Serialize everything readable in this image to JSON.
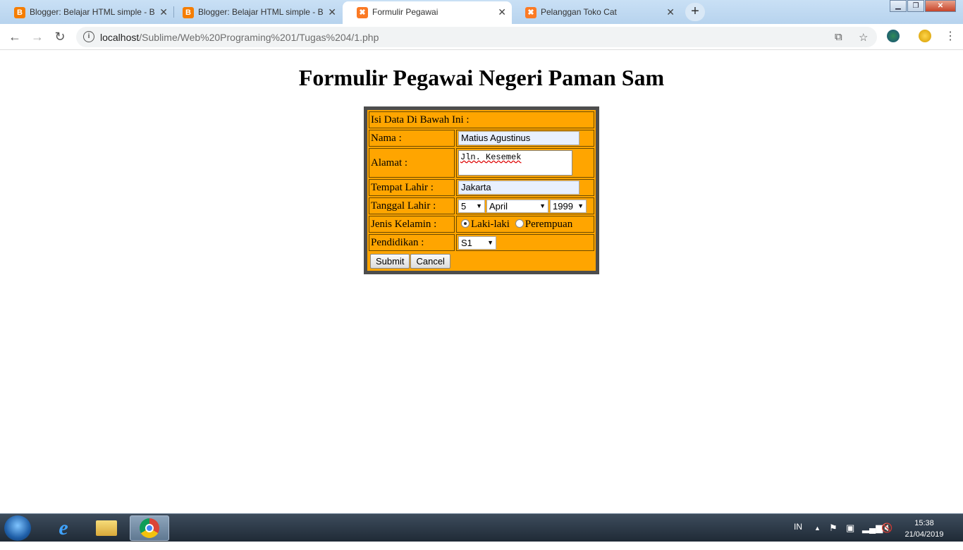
{
  "browser": {
    "tabs": [
      {
        "title": "Blogger: Belajar HTML simple - B",
        "icon": "blogger-icon",
        "active": false
      },
      {
        "title": "Blogger: Belajar HTML simple - B",
        "icon": "blogger-icon",
        "active": false
      },
      {
        "title": "Formulir Pegawai",
        "icon": "xampp-icon",
        "active": true
      },
      {
        "title": "Pelanggan Toko Cat",
        "icon": "xampp-icon",
        "active": false
      }
    ],
    "url_host": "localhost",
    "url_path": "/Sublime/Web%20Programing%201/Tugas%204/1.php"
  },
  "page": {
    "title": "Formulir Pegawai Negeri Paman Sam",
    "form": {
      "header": "Isi Data Di Bawah Ini :",
      "nama_label": "Nama :",
      "nama_value": "Matius Agustinus",
      "alamat_label": "Alamat :",
      "alamat_value": "Jln. Kesemek",
      "tempat_label": "Tempat Lahir :",
      "tempat_value": "Jakarta",
      "tanggal_label": "Tanggal Lahir :",
      "tanggal_day": "5",
      "tanggal_month": "April",
      "tanggal_year": "1999",
      "jk_label": "Jenis Kelamin :",
      "jk_option_1": "Laki-laki",
      "jk_option_2": "Perempuan",
      "jk_selected": "Laki-laki",
      "pendidikan_label": "Pendidikan :",
      "pendidikan_value": "S1",
      "submit_label": "Submit",
      "cancel_label": "Cancel"
    }
  },
  "taskbar": {
    "language": "IN",
    "time": "15:38",
    "date": "21/04/2019"
  }
}
